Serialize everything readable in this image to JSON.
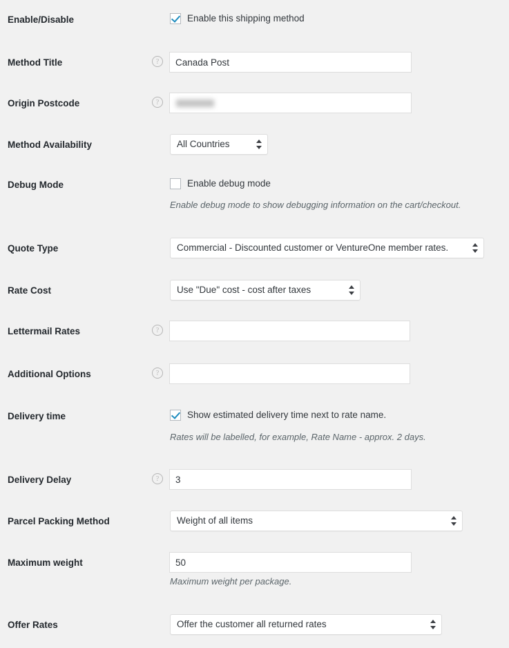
{
  "page": {
    "background_color": "#f1f1f1",
    "accent_color": "#1e8cbe",
    "label_color": "#23282d"
  },
  "rows": {
    "enable_disable": {
      "label": "Enable/Disable",
      "checkbox_label": "Enable this shipping method",
      "checked": true
    },
    "method_title": {
      "label": "Method Title",
      "value": "Canada Post",
      "help_icon": "help-icon"
    },
    "origin_postcode": {
      "label": "Origin Postcode",
      "value": "",
      "value_redacted": true,
      "help_icon": "help-icon"
    },
    "method_availability": {
      "label": "Method Availability",
      "value": "All Countries"
    },
    "debug_mode": {
      "label": "Debug Mode",
      "checkbox_label": "Enable debug mode",
      "checked": false,
      "description": "Enable debug mode to show debugging information on the cart/checkout."
    },
    "quote_type": {
      "label": "Quote Type",
      "value": "Commercial - Discounted customer or VentureOne member rates."
    },
    "rate_cost": {
      "label": "Rate Cost",
      "value": "Use \"Due\" cost - cost after taxes"
    },
    "lettermail_rates": {
      "label": "Lettermail Rates",
      "value": "",
      "help_icon": "help-icon"
    },
    "additional_options": {
      "label": "Additional Options",
      "value": "",
      "help_icon": "help-icon"
    },
    "delivery_time": {
      "label": "Delivery time",
      "checkbox_label": "Show estimated delivery time next to rate name.",
      "checked": true,
      "description": "Rates will be labelled, for example, Rate Name - approx. 2 days."
    },
    "delivery_delay": {
      "label": "Delivery Delay",
      "value": "3",
      "help_icon": "help-icon"
    },
    "parcel_packing_method": {
      "label": "Parcel Packing Method",
      "value": "Weight of all items"
    },
    "maximum_weight": {
      "label": "Maximum weight",
      "value": "50",
      "description": "Maximum weight per package."
    },
    "offer_rates": {
      "label": "Offer Rates",
      "value": "Offer the customer all returned rates"
    }
  }
}
